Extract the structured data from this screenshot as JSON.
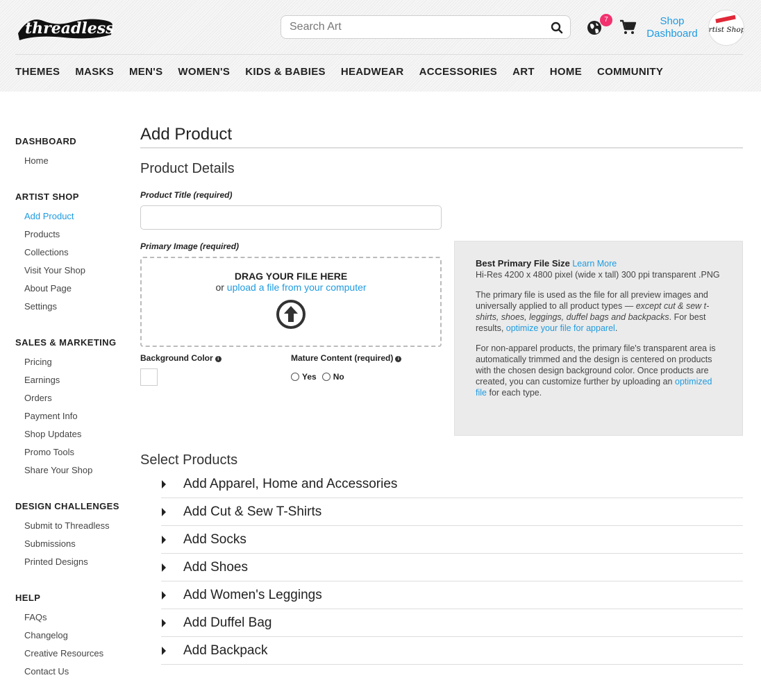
{
  "header": {
    "logo_text": "threadless",
    "search_placeholder": "Search Art",
    "notification_count": "7",
    "shop_dashboard_label": "Shop Dashboard",
    "artist_shops_logo_text": "Artist Shops",
    "nav": [
      "THEMES",
      "MASKS",
      "MEN'S",
      "WOMEN'S",
      "KIDS & BABIES",
      "HEADWEAR",
      "ACCESSORIES",
      "ART",
      "HOME",
      "COMMUNITY"
    ]
  },
  "sidebar": {
    "sections": [
      {
        "title": "DASHBOARD",
        "items": [
          "Home"
        ]
      },
      {
        "title": "ARTIST SHOP",
        "items": [
          "Add Product",
          "Products",
          "Collections",
          "Visit Your Shop",
          "About Page",
          "Settings"
        ]
      },
      {
        "title": "SALES & MARKETING",
        "items": [
          "Pricing",
          "Earnings",
          "Orders",
          "Payment Info",
          "Shop Updates",
          "Promo Tools",
          "Share Your Shop"
        ]
      },
      {
        "title": "DESIGN CHALLENGES",
        "items": [
          "Submit to Threadless",
          "Submissions",
          "Printed Designs"
        ]
      },
      {
        "title": "HELP",
        "items": [
          "FAQs",
          "Changelog",
          "Creative Resources",
          "Contact Us"
        ]
      }
    ],
    "active_item": "Add Product"
  },
  "main": {
    "page_title": "Add Product",
    "details_title": "Product Details",
    "product_title_label": "Product Title (required)",
    "product_title_value": "",
    "primary_image_label": "Primary Image (required)",
    "drop_heading": "DRAG YOUR FILE HERE",
    "drop_or": "or",
    "drop_link": "upload a file from your computer",
    "background_color_label": "Background Color",
    "mature_label": "Mature Content (required)",
    "mature_yes": "Yes",
    "mature_no": "No",
    "info": {
      "heading": "Best Primary File Size",
      "learn_more": "Learn More",
      "spec": "Hi-Res 4200 x 4800 pixel (wide x tall) 300 ppi transparent .PNG",
      "p1_a": "The primary file is used as the file for all preview images and universally applied to all product types —",
      "p1_em": "except cut & sew t-shirts, shoes, leggings, duffel bags and backpacks",
      "p1_b": ". For best results,",
      "p1_link": "optimize your file for apparel",
      "p1_c": ".",
      "p2_a": "For non-apparel products, the primary file's transparent area is automatically trimmed and the design is centered on products with the chosen design background color. Once products are created, you can customize further by uploading an",
      "p2_link": "optimized file",
      "p2_b": "for each type."
    },
    "select_title": "Select Products",
    "products": [
      "Add Apparel, Home and Accessories",
      "Add Cut & Sew T-Shirts",
      "Add Socks",
      "Add Shoes",
      "Add Women's Leggings",
      "Add Duffel Bag",
      "Add Backpack"
    ]
  }
}
